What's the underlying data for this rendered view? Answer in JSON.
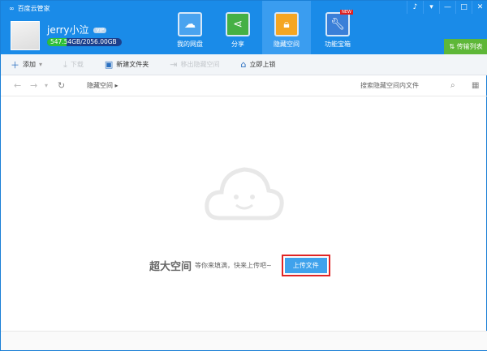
{
  "app": {
    "title": "百度云管家"
  },
  "window": {
    "buttons": [
      "bell",
      "menu",
      "minimize",
      "maximize",
      "close"
    ]
  },
  "user": {
    "name": "jerry小泣",
    "badge": "VIP",
    "quota_text": "547.54GB/2056.00GB",
    "quota_fraction": 0.266
  },
  "nav": [
    {
      "label": "我的网盘",
      "icon": "cloud-icon"
    },
    {
      "label": "分享",
      "icon": "share-icon"
    },
    {
      "label": "隐藏空间",
      "icon": "lock-icon",
      "active": true
    },
    {
      "label": "功能宝箱",
      "icon": "wrench-icon",
      "badge": "NEW"
    }
  ],
  "transfer_label": "传输列表",
  "toolbar": {
    "add": "添加",
    "download": "下载",
    "new_folder": "新建文件夹",
    "move_out": "移出隐藏空间",
    "lock": "立即上锁"
  },
  "breadcrumb": "隐藏空间",
  "search_placeholder": "搜索隐藏空间内文件",
  "empty": {
    "big": "超大空间",
    "small": "等你来填满，快来上传吧~",
    "upload": "上传文件"
  },
  "colors": {
    "header": "#1a8be8",
    "accent_green": "#5eb738",
    "highlight": "#e02424"
  }
}
